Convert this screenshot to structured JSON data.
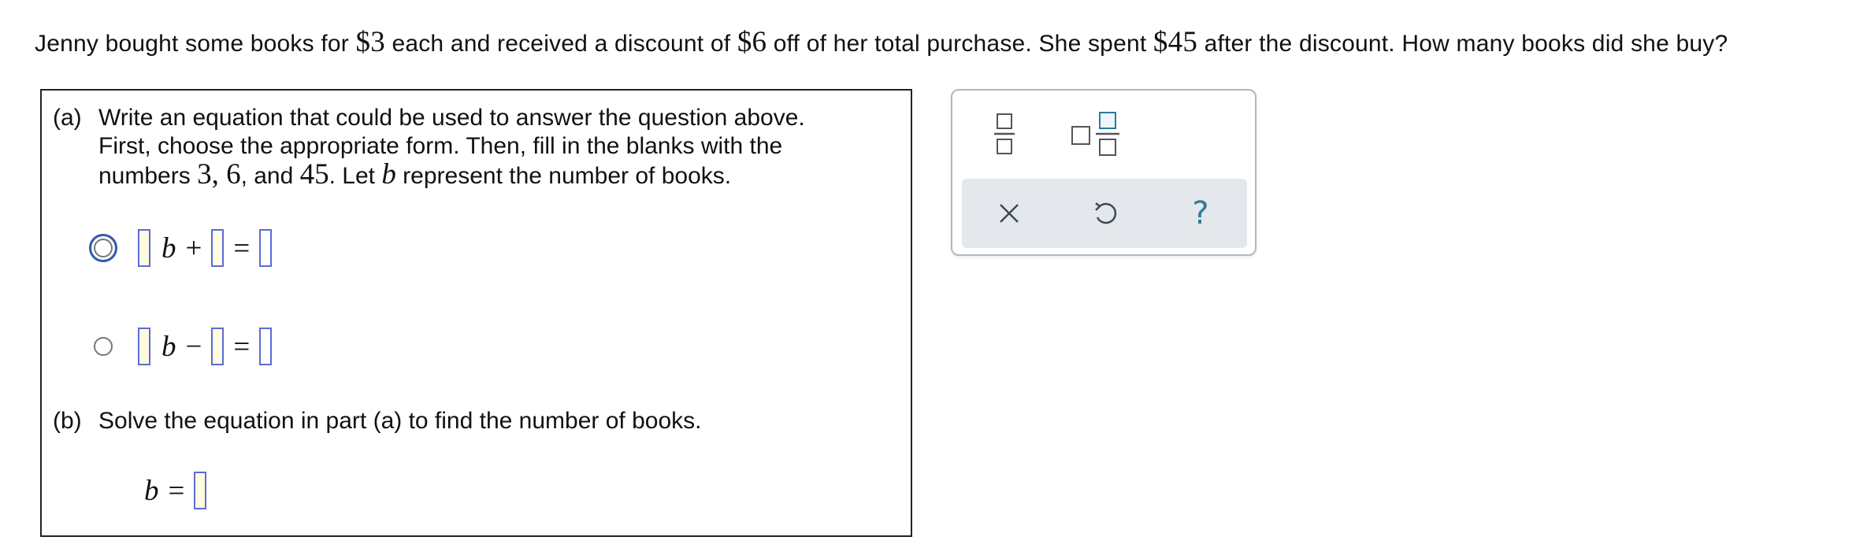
{
  "question": {
    "before_cost": "Jenny bought some books for ",
    "cost": "$3",
    "between_cost_discount": " each and received a discount of ",
    "discount": "$6",
    "between_discount_total": " off of her total purchase. She spent ",
    "total": "$45",
    "after_total": " after the discount. How many books did she buy?"
  },
  "part_a": {
    "tag": "(a)",
    "line1": "Write an equation that could be used to answer the question above.",
    "line2": "First, choose the appropriate form. Then, fill in the blanks with the",
    "line3_start": "numbers ",
    "n1": "3",
    "comma": ", ",
    "n2": "6",
    "and_text": ", and ",
    "n3": "45",
    "let_text": ". Let ",
    "var": "b",
    "end_text": " represent the number of books."
  },
  "options": [
    {
      "variable": "b",
      "operator": "+",
      "equals": "="
    },
    {
      "variable": "b",
      "operator": "−",
      "equals": "="
    }
  ],
  "part_b": {
    "tag": "(b)",
    "text": "Solve the equation in part (a) to find the number of books.",
    "answer_var": "b",
    "equals": "="
  },
  "toolbar": {
    "tools": [
      "fraction-icon",
      "mixed-number-icon"
    ],
    "actions": [
      "clear-icon",
      "undo-icon",
      "help-icon"
    ],
    "help_glyph": "?"
  },
  "colors": {
    "blank_border": "#5b6bd6",
    "blank_fill": "#fffbe0",
    "focus_ring": "#2e5da8",
    "action_bar": "#e4e8ec",
    "icon_teal": "#2d7b9c"
  }
}
